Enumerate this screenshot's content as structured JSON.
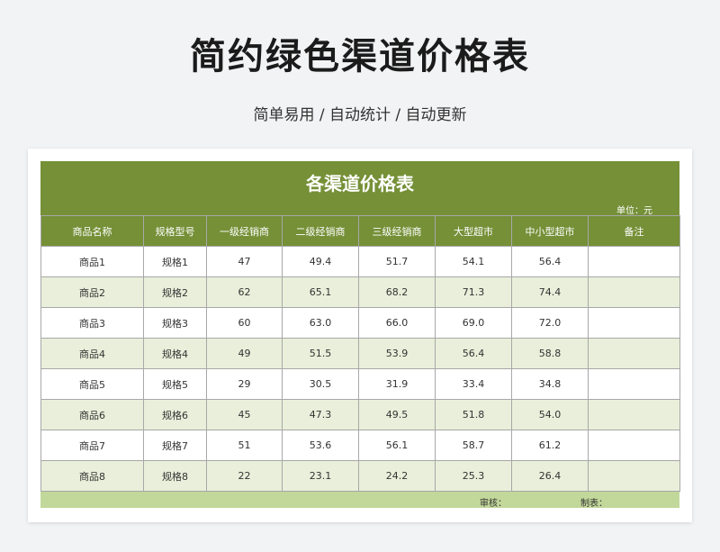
{
  "page": {
    "title": "简约绿色渠道价格表",
    "subtitle": "简单易用 / 自动统计 / 自动更新"
  },
  "sheet": {
    "title": "各渠道价格表",
    "unit": "单位：元",
    "headers": [
      "商品名称",
      "规格型号",
      "一级经销商",
      "二级经销商",
      "三级经销商",
      "大型超市",
      "中小型超市",
      "备注"
    ],
    "rows": [
      [
        "商品1",
        "规格1",
        "47",
        "49.4",
        "51.7",
        "54.1",
        "56.4",
        ""
      ],
      [
        "商品2",
        "规格2",
        "62",
        "65.1",
        "68.2",
        "71.3",
        "74.4",
        ""
      ],
      [
        "商品3",
        "规格3",
        "60",
        "63.0",
        "66.0",
        "69.0",
        "72.0",
        ""
      ],
      [
        "商品4",
        "规格4",
        "49",
        "51.5",
        "53.9",
        "56.4",
        "58.8",
        ""
      ],
      [
        "商品5",
        "规格5",
        "29",
        "30.5",
        "31.9",
        "33.4",
        "34.8",
        ""
      ],
      [
        "商品6",
        "规格6",
        "45",
        "47.3",
        "49.5",
        "51.8",
        "54.0",
        ""
      ],
      [
        "商品7",
        "规格7",
        "51",
        "53.6",
        "56.1",
        "58.7",
        "61.2",
        ""
      ],
      [
        "商品8",
        "规格8",
        "22",
        "23.1",
        "24.2",
        "25.3",
        "26.4",
        ""
      ]
    ],
    "footer": {
      "audit_label": "审核：",
      "maker_label": "制表："
    }
  },
  "colors": {
    "header_green": "#759037",
    "row_alt": "#e9efda",
    "footer_green": "#c2d79a"
  }
}
